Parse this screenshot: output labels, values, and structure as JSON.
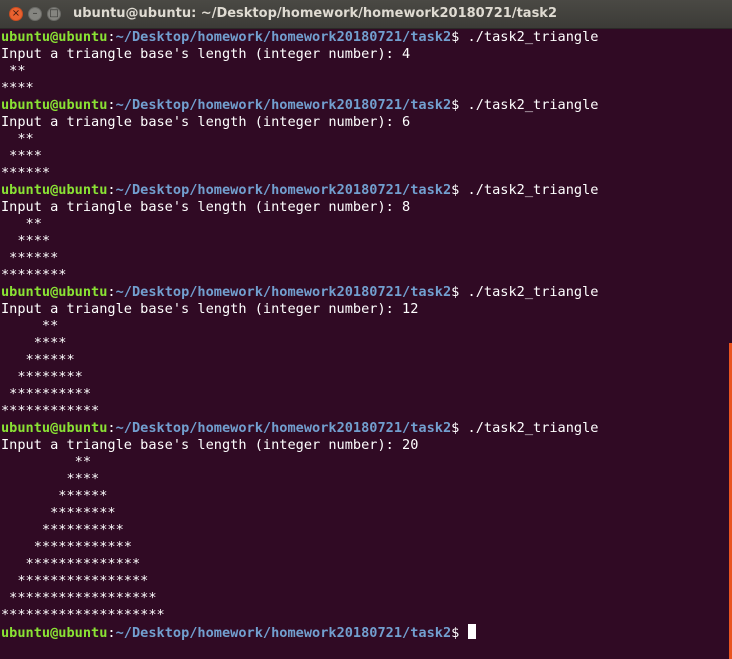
{
  "window": {
    "title": "ubuntu@ubuntu: ~/Desktop/homework/homework20180721/task2",
    "close_glyph": "×",
    "minimize_glyph": "–",
    "maximize_glyph": "□"
  },
  "prompt": {
    "user": "ubuntu@ubuntu",
    "colon": ":",
    "path": "~/Desktop/homework/homework20180721/task2",
    "symbol": "$ "
  },
  "commands": {
    "c1": "./task2_triangle",
    "c2": "./task2_triangle",
    "c3": "./task2_triangle",
    "c4": "./task2_triangle",
    "c5": "./task2_triangle"
  },
  "output": {
    "r1": [
      "Input a triangle base's length (integer number): 4",
      " **",
      "****"
    ],
    "r2": [
      "Input a triangle base's length (integer number): 6",
      "  **",
      " ****",
      "******"
    ],
    "r3": [
      "Input a triangle base's length (integer number): 8",
      "   **",
      "  ****",
      " ******",
      "********"
    ],
    "r4": [
      "Input a triangle base's length (integer number): 12",
      "     **",
      "    ****",
      "   ******",
      "  ********",
      " **********",
      "************"
    ],
    "r5": [
      "Input a triangle base's length (integer number): 20",
      "         **",
      "        ****",
      "       ******",
      "      ********",
      "     **********",
      "    ************",
      "   **************",
      "  ****************",
      " ******************",
      "********************"
    ]
  },
  "colors": {
    "background": "#300a24",
    "user": "#8ae234",
    "path": "#729fcf",
    "text": "#ffffff",
    "scrollbar": "#e95420"
  }
}
